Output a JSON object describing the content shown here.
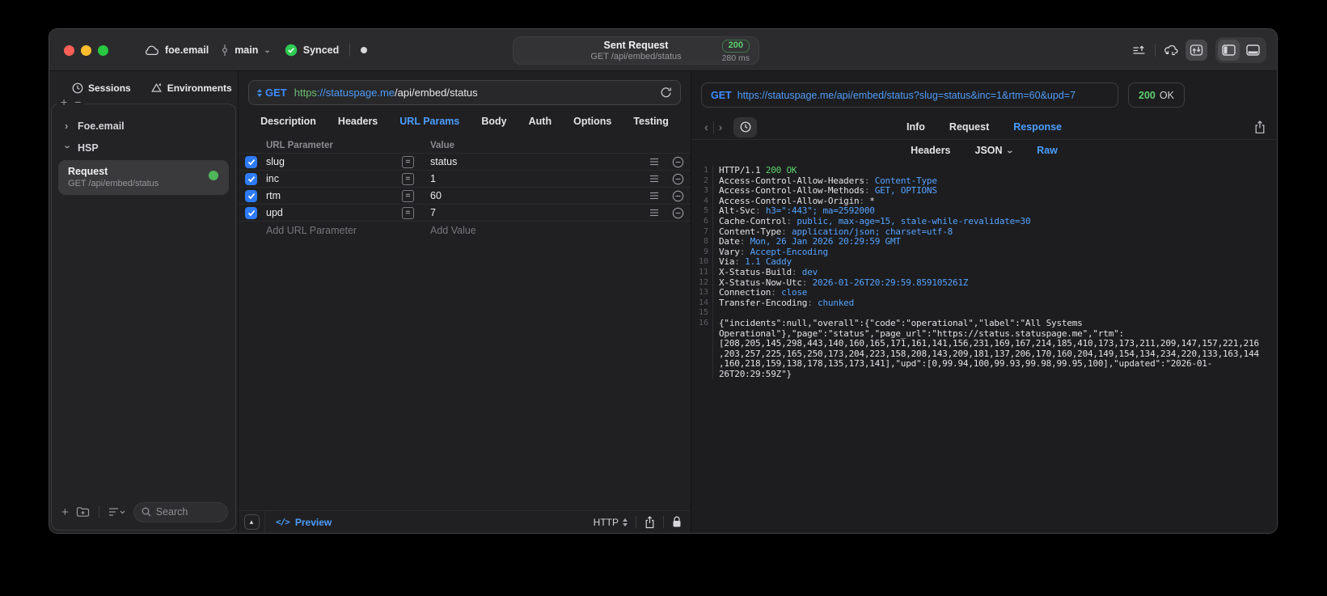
{
  "titlebar": {
    "workspace": "foe.email",
    "branch": "main",
    "sync_label": "Synced",
    "request_title": "Sent Request",
    "request_subtitle": "GET /api/embed/status",
    "status_code": "200",
    "duration": "280 ms"
  },
  "sidebar": {
    "tabs": [
      {
        "label": "Sessions"
      },
      {
        "label": "Environments"
      }
    ],
    "tree": [
      {
        "label": "Foe.email",
        "state": "collapsed"
      },
      {
        "label": "HSP",
        "state": "expanded"
      }
    ],
    "request_item": {
      "title": "Request",
      "subtitle": "GET /api/embed/status"
    },
    "search_placeholder": "Search"
  },
  "request_editor": {
    "method": "GET",
    "url": {
      "scheme": "https",
      "host": "://statuspage.me",
      "path": "/api/embed/status"
    },
    "tabs": [
      "Description",
      "Headers",
      "URL Params",
      "Body",
      "Auth",
      "Options",
      "Testing"
    ],
    "active_tab": "URL Params",
    "params": {
      "columns": [
        "URL Parameter",
        "Value"
      ],
      "rows": [
        {
          "name": "slug",
          "value": "status",
          "checked": true
        },
        {
          "name": "inc",
          "value": "1",
          "checked": true
        },
        {
          "name": "rtm",
          "value": "60",
          "checked": true
        },
        {
          "name": "upd",
          "value": "7",
          "checked": true
        }
      ],
      "add_param_placeholder": "Add URL Parameter",
      "add_value_placeholder": "Add Value"
    },
    "footer": {
      "preview_code": "</>",
      "preview_label": "Preview",
      "protocol_label": "HTTP"
    }
  },
  "response_viewer": {
    "request_line": {
      "method": "GET",
      "url": "https://statuspage.me/api/embed/status?slug=status&inc=1&rtm=60&upd=7"
    },
    "status": {
      "code": "200",
      "text": "OK"
    },
    "tabs": [
      "Info",
      "Request",
      "Response"
    ],
    "active_tab": "Response",
    "subtabs": [
      {
        "label": "Headers"
      },
      {
        "label": "JSON",
        "caret": true
      },
      {
        "label": "Raw"
      }
    ],
    "active_subtab": "Raw",
    "body_lines": [
      {
        "n": "1",
        "parts": [
          [
            "w",
            "HTTP/1.1 "
          ],
          [
            "g",
            "200 OK"
          ]
        ]
      },
      {
        "n": "2",
        "parts": [
          [
            "w",
            "Access-Control-Allow-Headers"
          ],
          [
            "d",
            ": "
          ],
          [
            "b",
            "Content-Type"
          ]
        ]
      },
      {
        "n": "3",
        "parts": [
          [
            "w",
            "Access-Control-Allow-Methods"
          ],
          [
            "d",
            ": "
          ],
          [
            "b",
            "GET, OPTIONS"
          ]
        ]
      },
      {
        "n": "4",
        "parts": [
          [
            "w",
            "Access-Control-Allow-Origin"
          ],
          [
            "d",
            ": "
          ],
          [
            "w",
            "*"
          ]
        ]
      },
      {
        "n": "5",
        "parts": [
          [
            "w",
            "Alt-Svc"
          ],
          [
            "d",
            ": "
          ],
          [
            "b",
            "h3=\":443\"; ma=2592000"
          ]
        ]
      },
      {
        "n": "6",
        "parts": [
          [
            "w",
            "Cache-Control"
          ],
          [
            "d",
            ": "
          ],
          [
            "b",
            "public, max-age=15, stale-while-revalidate=30"
          ]
        ]
      },
      {
        "n": "7",
        "parts": [
          [
            "w",
            "Content-Type"
          ],
          [
            "d",
            ": "
          ],
          [
            "b",
            "application/json; charset=utf-8"
          ]
        ]
      },
      {
        "n": "8",
        "parts": [
          [
            "w",
            "Date"
          ],
          [
            "d",
            ": "
          ],
          [
            "b",
            "Mon, 26 Jan 2026 20:29:59 GMT"
          ]
        ]
      },
      {
        "n": "9",
        "parts": [
          [
            "w",
            "Vary"
          ],
          [
            "d",
            ": "
          ],
          [
            "b",
            "Accept-Encoding"
          ]
        ]
      },
      {
        "n": "10",
        "parts": [
          [
            "w",
            "Via"
          ],
          [
            "d",
            ": "
          ],
          [
            "b",
            "1.1 Caddy"
          ]
        ]
      },
      {
        "n": "11",
        "parts": [
          [
            "w",
            "X-Status-Build"
          ],
          [
            "d",
            ": "
          ],
          [
            "b",
            "dev"
          ]
        ]
      },
      {
        "n": "12",
        "parts": [
          [
            "w",
            "X-Status-Now-Utc"
          ],
          [
            "d",
            ": "
          ],
          [
            "b",
            "2026-01-26T20:29:59.859105261Z"
          ]
        ]
      },
      {
        "n": "13",
        "parts": [
          [
            "w",
            "Connection"
          ],
          [
            "d",
            ": "
          ],
          [
            "b",
            "close"
          ]
        ]
      },
      {
        "n": "14",
        "parts": [
          [
            "w",
            "Transfer-Encoding"
          ],
          [
            "d",
            ": "
          ],
          [
            "b",
            "chunked"
          ]
        ]
      },
      {
        "n": "15",
        "parts": []
      },
      {
        "n": "16",
        "parts": [
          [
            "w",
            "{\"incidents\":null,\"overall\":{\"code\":\"operational\",\"label\":\"All Systems Operational\"},\"page\":\"status\",\"page_url\":\"https://status.statuspage.me\",\"rtm\":[208,205,145,298,443,140,160,165,171,161,141,156,231,169,167,214,185,410,173,173,211,209,147,157,221,216,203,257,225,165,250,173,204,223,158,208,143,209,181,137,206,170,160,204,149,154,134,234,220,133,163,144,160,218,159,138,178,135,173,141],\"upd\":[0,99.94,100,99.93,99.98,99.95,100],\"updated\":\"2026-01-26T20:29:59Z\"}"
          ]
        ]
      }
    ]
  },
  "colors": {
    "accent_blue": "#4b9eff",
    "status_green": "#5ed26e",
    "checkbox_blue": "#2e7bf6"
  }
}
